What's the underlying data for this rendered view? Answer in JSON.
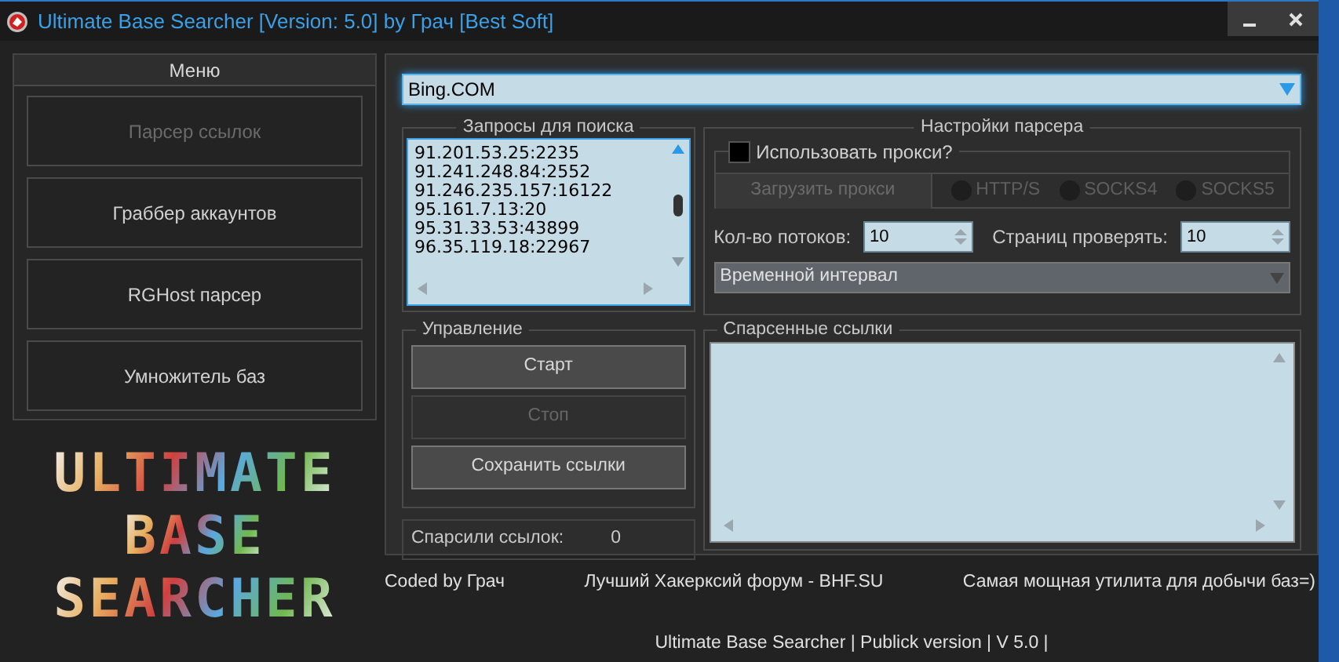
{
  "window": {
    "title": "Ultimate Base Searcher [Version: 5.0] by Грач [Best Soft]"
  },
  "menu": {
    "title": "Меню",
    "items": [
      {
        "label": "Парсер ссылок",
        "disabled": true
      },
      {
        "label": "Граббер аккаунтов",
        "disabled": false
      },
      {
        "label": "RGHost парсер",
        "disabled": false
      },
      {
        "label": "Умножитель баз",
        "disabled": false
      }
    ]
  },
  "logo": {
    "lines": [
      "ULTIMATE",
      "BASE",
      "SEARCHER"
    ]
  },
  "search_engine": {
    "value": "Bing.COM"
  },
  "queries": {
    "title": "Запросы для поиска",
    "lines": [
      "91.201.53.25:2235",
      "91.241.248.84:2552",
      "91.246.235.157:16122",
      "95.161.7.13:20",
      "95.31.33.53:43899",
      "96.35.119.18:22967"
    ]
  },
  "settings": {
    "title": "Настройки парсера",
    "use_proxy": {
      "label": "Использовать прокси?",
      "checked": false
    },
    "load_proxy": {
      "label": "Загрузить прокси",
      "disabled": true
    },
    "proxy_types": [
      {
        "label": "HTTP/S",
        "selected": false
      },
      {
        "label": "SOCKS4",
        "selected": false
      },
      {
        "label": "SOCKS5",
        "selected": false
      }
    ],
    "threads": {
      "label": "Кол-во потоков:",
      "value": "10"
    },
    "pages": {
      "label": "Страниц проверять:",
      "value": "10"
    },
    "interval": {
      "value": "Временной интервал"
    }
  },
  "control": {
    "title": "Управление",
    "buttons": [
      {
        "label": "Старт",
        "disabled": false
      },
      {
        "label": "Стоп",
        "disabled": true
      },
      {
        "label": "Сохранить ссылки",
        "disabled": false
      }
    ]
  },
  "counter": {
    "label": "Спарсили ссылок:",
    "value": "0"
  },
  "parsed_links": {
    "title": "Спарсенные ссылки"
  },
  "footer": {
    "left": "Coded by Грач",
    "center": "Лучший Хакерксий форум - BHF.SU",
    "right": "Самая мощная утилита для добычи баз=)",
    "bottom": "Ultimate Base Searcher | Publick version | V 5.0 |"
  }
}
